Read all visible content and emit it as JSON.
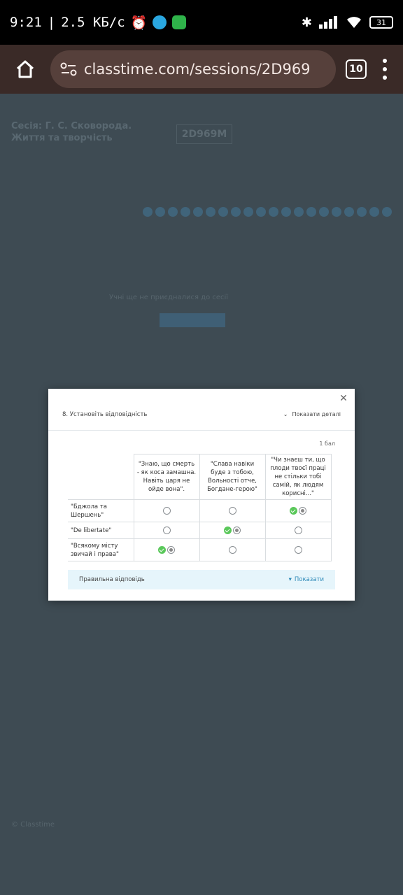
{
  "status": {
    "time": "9:21",
    "speed": "2.5 КБ/с",
    "battery": "31"
  },
  "browser": {
    "url": "classtime.com/sessions/2D969",
    "tab_count": "10"
  },
  "background": {
    "session_title": "Сесія: Г. С. Сковорода. Життя та творчість",
    "session_code": "2D969M",
    "student_notice": "Учні ще не приєдналися до сесії",
    "footer": "© Classtime"
  },
  "modal": {
    "question_title": "8. Установіть відповідність",
    "details_toggle": "Показати деталі",
    "points": "1 бал",
    "columns": [
      "\"Знаю, що смерть - як коса замашна. Навіть царя не ойде вона\".",
      "\"Слава навіки буде з тобою, Вольності отче, Богдане-герою\"",
      "\"Чи знаєш ти, що плоди твоєї праці не стільки тобі самій, як людям корисні...\""
    ],
    "rows": [
      {
        "label": "\"Бджола та Шершень\"",
        "selected": 2,
        "correct": 2
      },
      {
        "label": "\"De libertate\"",
        "selected": 1,
        "correct": 1
      },
      {
        "label": "\"Всякому місту звичай і права\"",
        "selected": 0,
        "correct": 0
      }
    ],
    "correct_answer_label": "Правильна відповідь",
    "show_label": "Показати"
  }
}
